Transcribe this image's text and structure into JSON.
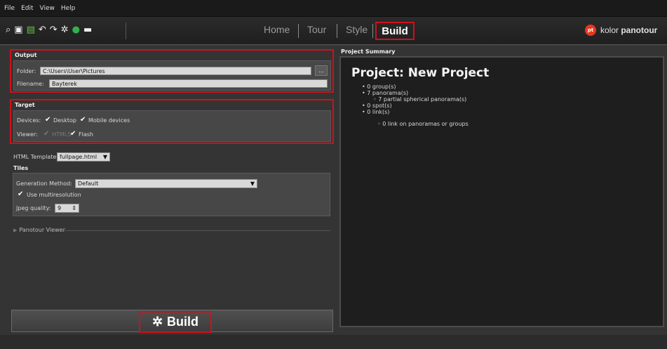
{
  "menu": [
    "File",
    "Edit",
    "View",
    "Help"
  ],
  "toolbar": {
    "icons": [
      "search-icon",
      "save-icon",
      "export-icon",
      "undo-icon",
      "redo-icon",
      "settings-icon",
      "play-icon",
      "book-icon"
    ],
    "glyphs": [
      "⌕",
      "▣",
      "▤",
      "↶",
      "↷",
      "✲",
      "●",
      "▬"
    ]
  },
  "nav": {
    "home": "Home",
    "tour": "Tour",
    "style": "Style",
    "build": "Build"
  },
  "brand": {
    "logo": "pt",
    "name_prefix": "kolor ",
    "name_bold": "panotour"
  },
  "output": {
    "title": "Output",
    "folder_label": "Folder:",
    "folder_value": "C:\\Users\\User\\Pictures",
    "browse_label": "...",
    "filename_label": "Filename:",
    "filename_value": "Bayterek"
  },
  "target": {
    "title": "Target",
    "devices_label": "Devices:",
    "desktop_label": "Desktop",
    "mobile_label": "Mobile devices",
    "viewer_label": "Viewer:",
    "html5_label": "HTML5",
    "flash_label": "Flash"
  },
  "html_template": {
    "label": "HTML Template:",
    "value": "fullpage.html"
  },
  "tiles": {
    "title": "Tiles",
    "method_label": "Generation Method:",
    "method_value": "Default",
    "multires_label": "Use multiresolution",
    "jpeg_label": "Jpeg quality:",
    "jpeg_value": "9"
  },
  "panotour_viewer": {
    "label": "Panotour Viewer"
  },
  "summary": {
    "title": "Project Summary",
    "heading": "Project: New Project",
    "groups": "• 0 group(s)",
    "panoramas": "• 7 panorama(s)",
    "partial": "◦ 7 partial spherical panorama(s)",
    "spots": "• 0 spot(s)",
    "links": "• 0 link(s)",
    "links_detail": "◦ 0 link on panoramas or groups"
  },
  "build_button": {
    "label": "Build"
  }
}
